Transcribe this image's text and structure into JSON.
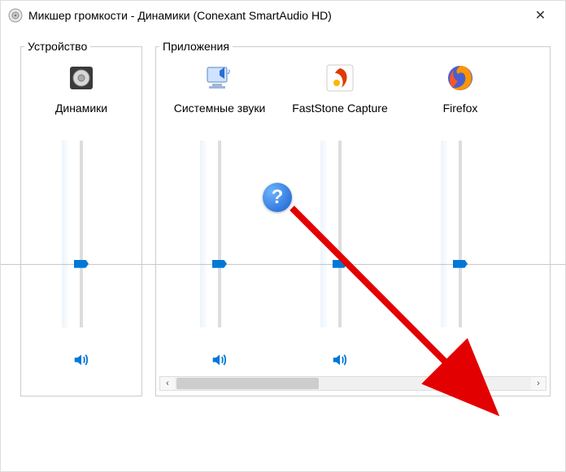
{
  "window": {
    "title": "Микшер громкости - Динамики (Conexant SmartAudio HD)",
    "close_symbol": "✕"
  },
  "sections": {
    "device_label": "Устройство",
    "apps_label": "Приложения"
  },
  "device": {
    "name": "Динамики",
    "icon": "speaker-device-icon",
    "level_percent": 34,
    "muted": false
  },
  "apps": [
    {
      "name": "Системные звуки",
      "icon": "system-sounds-icon",
      "level_percent": 34,
      "muted": false
    },
    {
      "name": "FastStone Capture",
      "icon": "faststone-icon",
      "level_percent": 34,
      "muted": false
    },
    {
      "name": "Firefox",
      "icon": "firefox-icon",
      "level_percent": 34,
      "muted": true
    }
  ],
  "baseline_percent": 34,
  "annotation": {
    "help_symbol": "?",
    "scroll_left": "‹",
    "scroll_right": "›"
  }
}
